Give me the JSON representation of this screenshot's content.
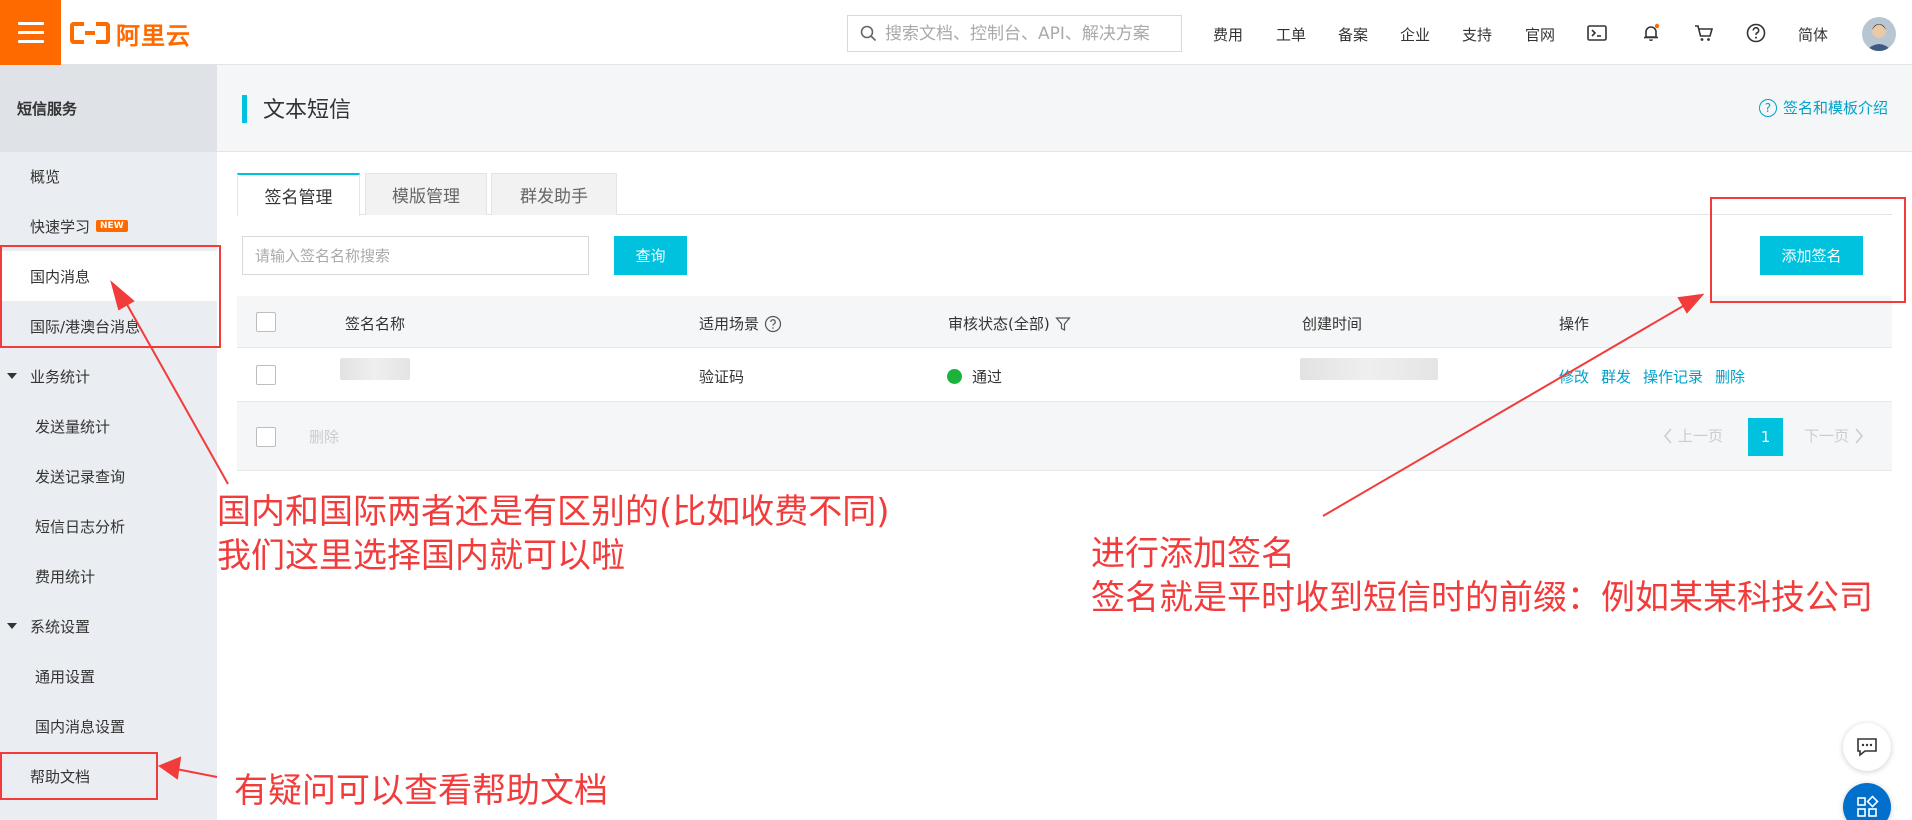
{
  "topbar": {
    "logo_text": "阿里云",
    "search_placeholder": "搜索文档、控制台、API、解决方案",
    "nav": [
      "费用",
      "工单",
      "备案",
      "企业",
      "支持",
      "官网"
    ],
    "lang": "简体"
  },
  "sidebar": {
    "title": "短信服务",
    "items": [
      {
        "label": "概览"
      },
      {
        "label": "快速学习",
        "badge": "NEW"
      },
      {
        "label": "国内消息"
      },
      {
        "label": "国际/港澳台消息"
      },
      {
        "label": "业务统计"
      },
      {
        "label": "发送量统计"
      },
      {
        "label": "发送记录查询"
      },
      {
        "label": "短信日志分析"
      },
      {
        "label": "费用统计"
      },
      {
        "label": "系统设置"
      },
      {
        "label": "通用设置"
      },
      {
        "label": "国内消息设置"
      },
      {
        "label": "帮助文档"
      }
    ]
  },
  "main": {
    "title": "文本短信",
    "help_link": "签名和模板介绍",
    "tabs": [
      "签名管理",
      "模版管理",
      "群发助手"
    ],
    "search_placeholder": "请输入签名名称搜索",
    "query_button": "查询",
    "add_button": "添加签名",
    "columns": [
      "签名名称",
      "适用场景",
      "审核状态(全部)",
      "创建时间",
      "操作"
    ],
    "row": {
      "scene": "验证码",
      "status": "通过",
      "actions": [
        "修改",
        "群发",
        "操作记录",
        "删除"
      ]
    },
    "delete_button": "删除",
    "pagination": {
      "prev": "上一页",
      "page": "1",
      "next": "下一页"
    }
  },
  "annotations": {
    "domestic_line1": "国内和国际两者还是有区别的(比如收费不同)",
    "domestic_line2": "我们这里选择国内就可以啦",
    "add_line1": "进行添加签名",
    "add_line2": "签名就是平时收到短信时的前缀：例如某某科技公司",
    "help_text": "有疑问可以查看帮助文档"
  },
  "colors": {
    "brand": "#ff6a00",
    "accent": "#00c1de",
    "link": "#00a2ca",
    "annotation": "#f23c3c",
    "success": "#1db23b"
  }
}
